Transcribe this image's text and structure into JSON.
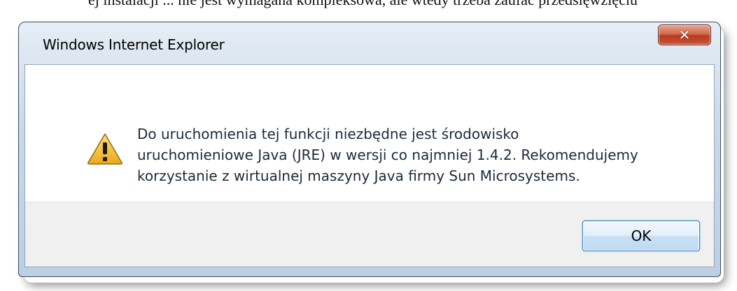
{
  "background_text": "ej instalacji ... nie jest wymagana kompleksowa, ale wtedy trzeba zaufać przedsięwzięciu",
  "dialog": {
    "title": "Windows Internet Explorer",
    "close_label": "✕",
    "icon": "warning-icon",
    "message": "Do uruchomienia tej funkcji niezbędne jest środowisko\nuruchomieniowe Java (JRE) w wersji co najmniej 1.4.2. Rekomendujemy\nkorzystanie z wirtualnej maszyny Java firmy Sun Microsystems.",
    "ok_label": "OK"
  },
  "colors": {
    "close_button": "#c85637",
    "ok_border": "#3c7fb1",
    "warning_fill": "#f6c23a"
  }
}
